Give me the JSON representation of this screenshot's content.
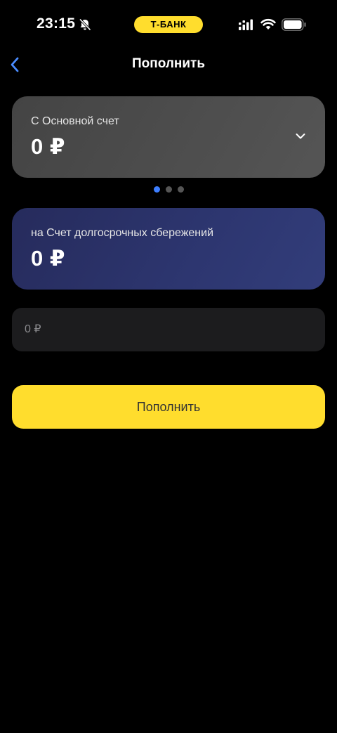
{
  "status_bar": {
    "time": "23:15",
    "carrier": "Т-БАНК",
    "icons": [
      "bell-slash-icon",
      "cellular-signal-icon",
      "wifi-icon",
      "battery-icon"
    ]
  },
  "nav": {
    "title": "Пополнить",
    "back_icon": "chevron-left-icon"
  },
  "from_account": {
    "label": "С Основной счет",
    "amount": "0 ₽",
    "chevron_icon": "chevron-down-icon"
  },
  "pager": {
    "count": 3,
    "active_index": 0
  },
  "to_account": {
    "label": "на Счет долгосрочных сбережений",
    "amount": "0 ₽"
  },
  "amount_input": {
    "value": "",
    "placeholder": "0 ₽"
  },
  "submit_button": {
    "label": "Пополнить"
  },
  "colors": {
    "accent": "#ffdd2d",
    "link_blue": "#3d7eff",
    "background": "#000000",
    "from_card": "#4a4a4a",
    "to_card": "#2d3670",
    "input_bg": "#1c1c1e"
  }
}
